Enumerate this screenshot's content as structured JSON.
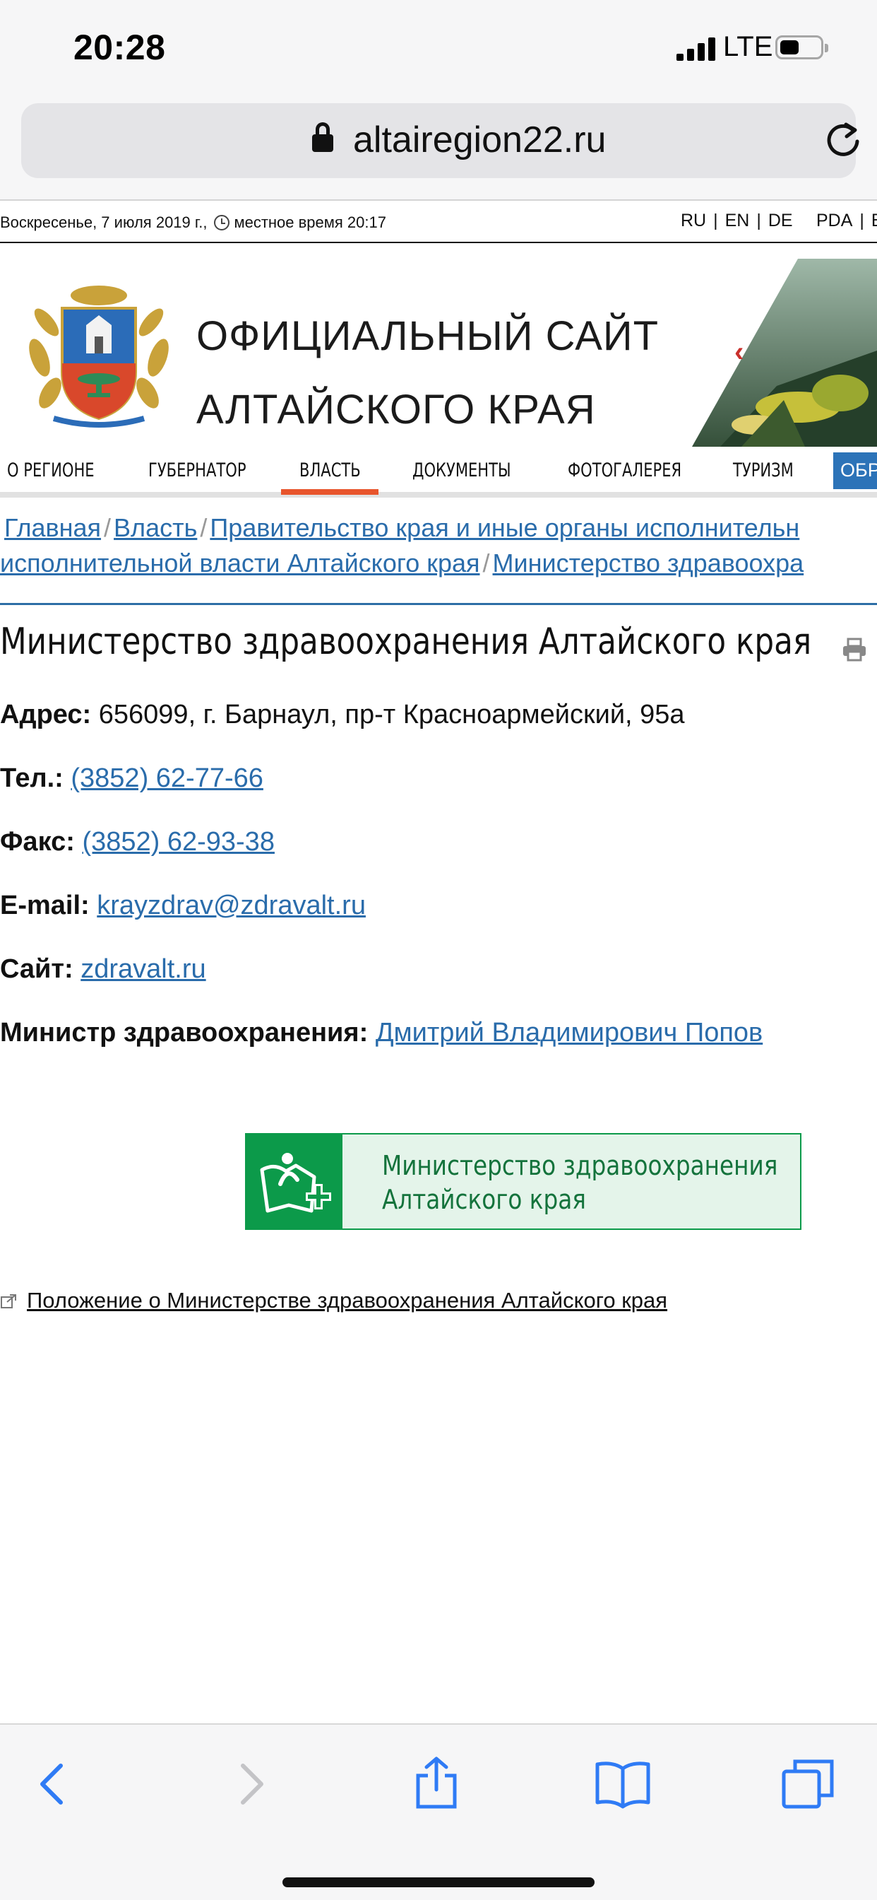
{
  "status_bar": {
    "time": "20:28",
    "network": "LTE"
  },
  "browser": {
    "url": "altairegion22.ru"
  },
  "topline": {
    "date": "Воскресенье, 7 июля 2019 г.,",
    "local_time_label": "местное время 20:17",
    "languages": [
      "RU",
      "EN",
      "DE"
    ],
    "pda": "PDA",
    "more": "В"
  },
  "header": {
    "title_line1": "ОФИЦИАЛЬНЫЙ САЙТ",
    "title_line2": "АЛТАЙСКОГО КРАЯ",
    "banner_arrow": "‹"
  },
  "nav": {
    "items": [
      "О РЕГИОНЕ",
      "ГУБЕРНАТОР",
      "ВЛАСТЬ",
      "ДОКУМЕНТЫ",
      "ФОТОГАЛЕРЕЯ",
      "ТУРИЗМ",
      "ОБРА"
    ],
    "active": "ВЛАСТЬ"
  },
  "breadcrumb": {
    "home": "Главная",
    "power": "Власть",
    "government": "Правительство края и иные органы исполнительн",
    "executive": "исполнительной власти Алтайского края",
    "ministry": "Министерство здравоохра",
    "separator": "/"
  },
  "page": {
    "title": "Министерство здравоохранения Алтайского края",
    "address_label": "Адрес:",
    "address_value": "656099, г. Барнаул, пр-т Красноармейский, 95а",
    "phone_label": "Тел.:",
    "phone_value": "(3852) 62-77-66",
    "fax_label": "Факс:",
    "fax_value": "(3852) 62-93-38",
    "email_label": "E-mail:",
    "email_value": "krayzdrav@zdravalt.ru",
    "site_label": "Сайт:",
    "site_value": "zdravalt.ru",
    "minister_label": "Министр здравоохранения:",
    "minister_value": "Дмитрий Владимирович Попов",
    "banner_line1": "Министерство здравоохранения",
    "banner_line2": "Алтайского края",
    "regulation_link": "Положение о Министерстве здравоохранения Алтайского края"
  },
  "colors": {
    "link": "#2a6cab",
    "nav_active": "#e8552c",
    "nav_highlight": "#2c73b8",
    "health_green": "#0c9a4a"
  }
}
